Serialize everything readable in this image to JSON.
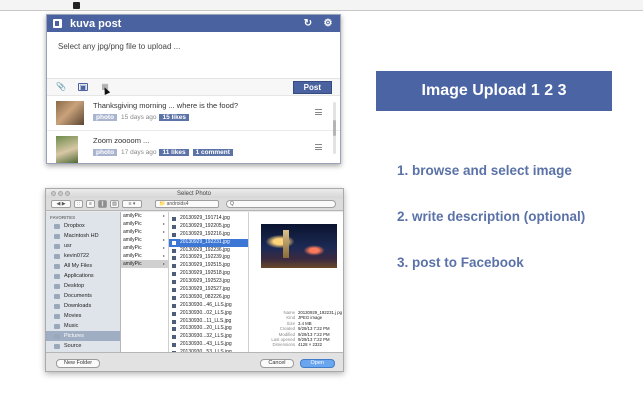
{
  "popup": {
    "app_title": "kuva post",
    "placeholder": "Select any jpg/png file to upload ...",
    "post_label": "Post",
    "items": [
      {
        "caption": "Thanksgiving morning ... where is the food?",
        "tag": "photo",
        "ago": "15 days ago",
        "likes": "15 likes",
        "comments": ""
      },
      {
        "caption": "Zoom zoooom ...",
        "tag": "photo",
        "ago": "17 days ago",
        "likes": "11 likes",
        "comments": "1 comment"
      }
    ]
  },
  "dialog": {
    "title": "Select Photo",
    "location": "androids4",
    "search_placeholder": "Q",
    "favorites_header": "FAVORITES",
    "sidebar": [
      "Dropbox",
      "Macintosh HD",
      "usr",
      "kevin0722",
      "All My Files",
      "Applications",
      "Desktop",
      "Documents",
      "Downloads",
      "Movies",
      "Music",
      "Pictures",
      "Source"
    ],
    "sidebar_selected": "Pictures",
    "column1": [
      "amilyPic",
      "amilyPic",
      "amilyPic",
      "amilyPic",
      "amilyPic",
      "amilyPic",
      "amilyPic"
    ],
    "files": [
      "20130929_191714.jpg",
      "20130929_192205.jpg",
      "20130929_192216.jpg",
      "20130929_192231.jpg",
      "20130929_192236.jpg",
      "20130929_192239.jpg",
      "20130929_192515.jpg",
      "20130929_192518.jpg",
      "20130929_192523.jpg",
      "20130929_192527.jpg",
      "20130930_082226.jpg",
      "20130930...46_LLS.jpg",
      "20130930...02_LLS.jpg",
      "20130930...11_LLS.jpg",
      "20130930...20_LLS.jpg",
      "20130930...32_LLS.jpg",
      "20130930...43_LLS.jpg",
      "20130930...53_LLS.jpg"
    ],
    "selected_file": "20130929_192231.jpg",
    "preview_meta": [
      {
        "k": "Name",
        "v": "20130929_192231.j pg"
      },
      {
        "k": "Kind",
        "v": "JPEG image"
      },
      {
        "k": "Size",
        "v": "3.4 MB"
      },
      {
        "k": "Created",
        "v": "9/29/13 7:22 PM"
      },
      {
        "k": "Modified",
        "v": "9/29/13 7:22 PM"
      },
      {
        "k": "Last opened",
        "v": "9/29/13 7:22 PM"
      },
      {
        "k": "Dimensions",
        "v": "4128 × 2322"
      }
    ],
    "new_folder_label": "New Folder",
    "cancel_label": "Cancel",
    "open_label": "Open"
  },
  "banner": "Image Upload 1 2 3",
  "steps": [
    "1. browse and select image",
    "2. write description (optional)",
    "3. post to Facebook"
  ]
}
